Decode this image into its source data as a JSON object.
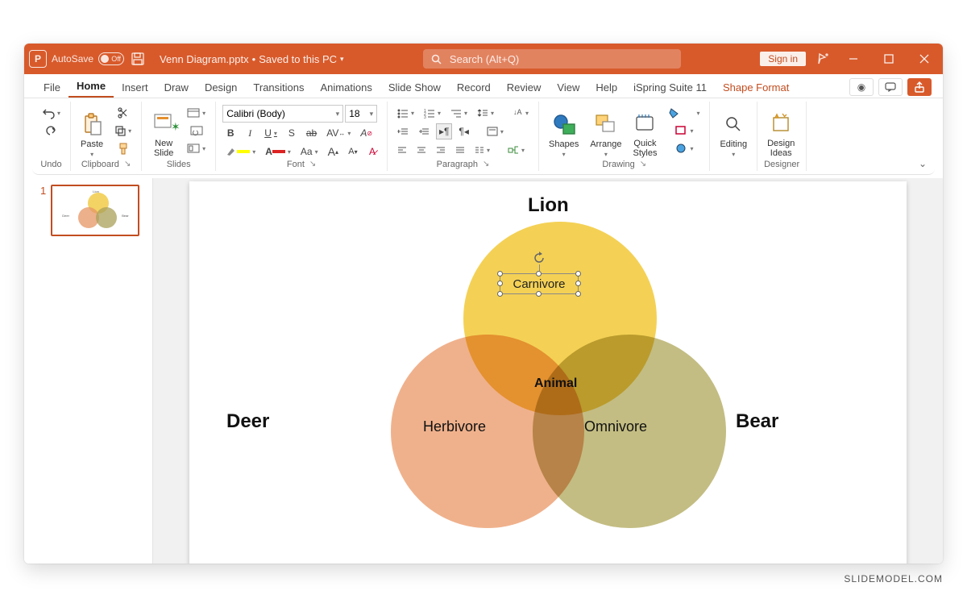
{
  "titlebar": {
    "autosave_label": "AutoSave",
    "autosave_state": "Off",
    "filename": "Venn Diagram.pptx",
    "save_status": "Saved to this PC",
    "search_placeholder": "Search (Alt+Q)",
    "sign_in": "Sign in"
  },
  "tabs": {
    "file": "File",
    "home": "Home",
    "insert": "Insert",
    "draw": "Draw",
    "design": "Design",
    "transitions": "Transitions",
    "animations": "Animations",
    "slideshow": "Slide Show",
    "record": "Record",
    "review": "Review",
    "view": "View",
    "help": "Help",
    "ispring": "iSpring Suite 11",
    "shape_format": "Shape Format"
  },
  "ribbon": {
    "undo": {
      "label": "Undo"
    },
    "clipboard": {
      "label": "Clipboard",
      "paste": "Paste"
    },
    "slides": {
      "label": "Slides",
      "newslide": "New\nSlide"
    },
    "font": {
      "label": "Font",
      "family": "Calibri (Body)",
      "size": "18",
      "bold": "B",
      "italic": "I",
      "underline": "U",
      "shadow": "S",
      "strike": "ab",
      "spacing": "AV",
      "clear": "A",
      "aA": "Aa",
      "inc": "A",
      "dec": "A"
    },
    "paragraph": {
      "label": "Paragraph"
    },
    "drawing": {
      "label": "Drawing",
      "shapes": "Shapes",
      "arrange": "Arrange",
      "quick": "Quick\nStyles"
    },
    "editing": {
      "label": "Editing"
    },
    "designer": {
      "label": "Designer",
      "ideas": "Design\nIdeas"
    }
  },
  "slide": {
    "number": "1",
    "labels": {
      "lion": "Lion",
      "deer": "Deer",
      "bear": "Bear",
      "carnivore": "Carnivore",
      "herbivore": "Herbivore",
      "omnivore": "Omnivore",
      "animal": "Animal"
    }
  },
  "watermark": "SLIDEMODEL.COM"
}
